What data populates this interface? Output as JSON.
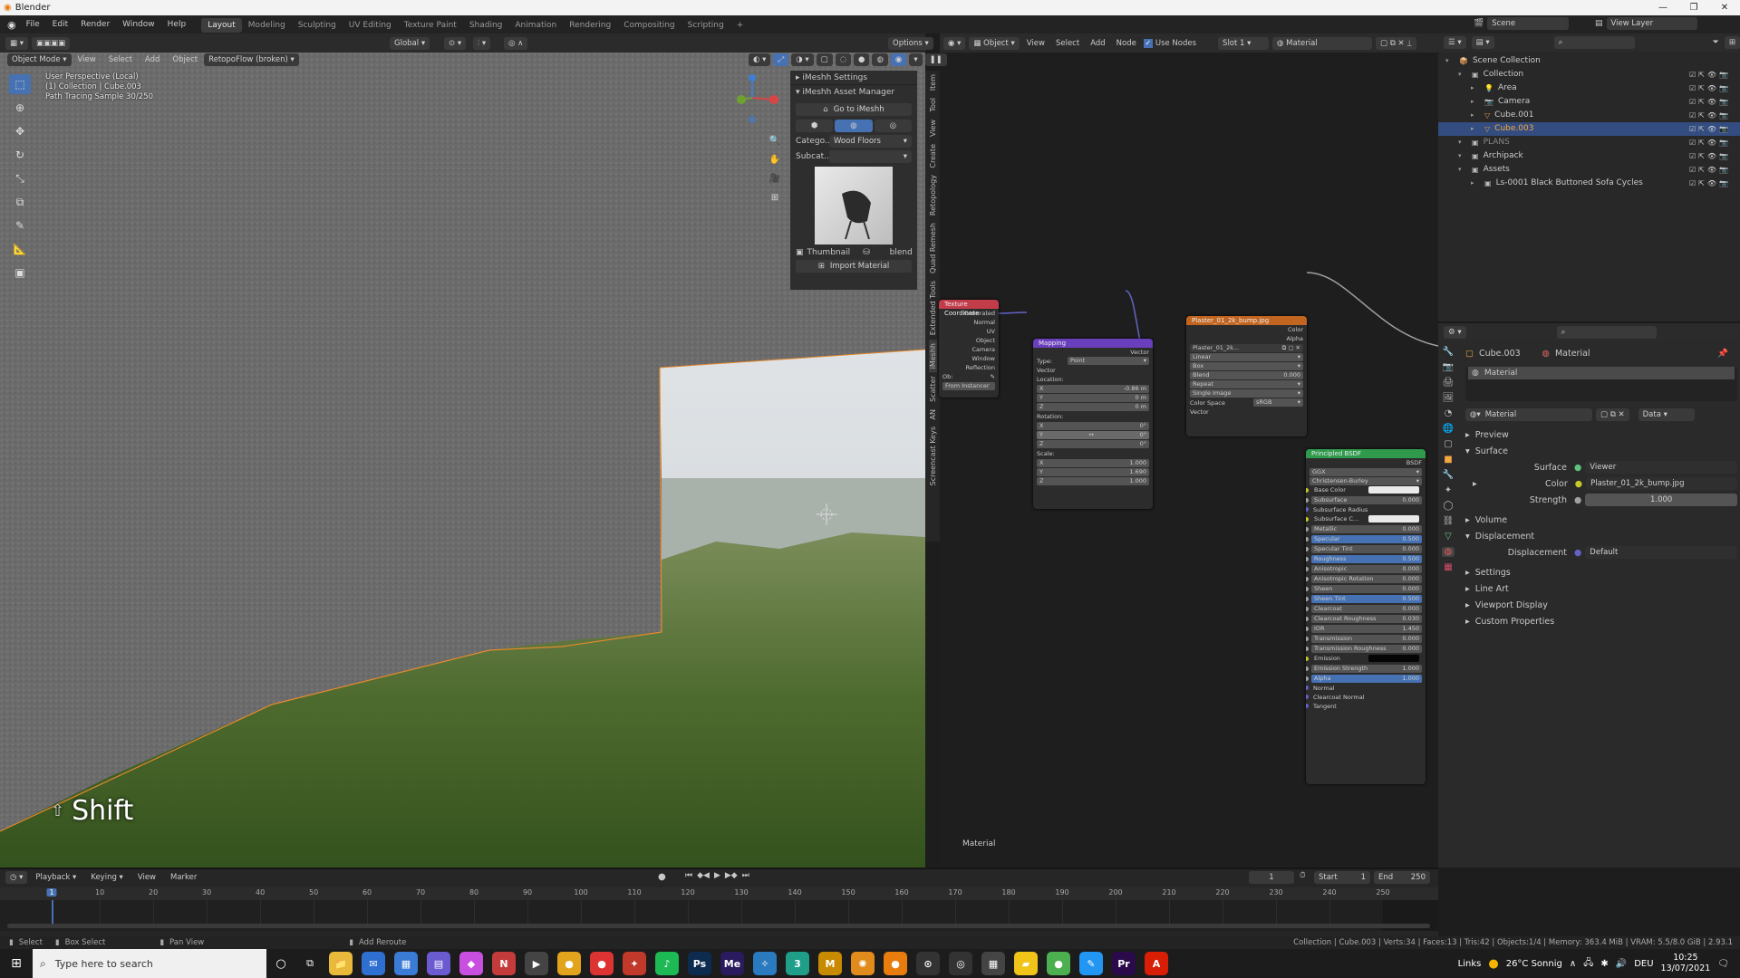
{
  "window": {
    "title": "Blender",
    "controls": [
      "—",
      "❐",
      "✕"
    ]
  },
  "menu": [
    "File",
    "Edit",
    "Render",
    "Window",
    "Help"
  ],
  "workspaces": [
    "Layout",
    "Modeling",
    "Sculpting",
    "UV Editing",
    "Texture Paint",
    "Shading",
    "Animation",
    "Rendering",
    "Compositing",
    "Scripting",
    "+"
  ],
  "topright": {
    "scene": "Scene",
    "view_layer": "View Layer"
  },
  "viewport": {
    "header": {
      "mode": "Object Mode",
      "menus": [
        "View",
        "Select",
        "Add",
        "Object"
      ],
      "addon": "RetopoFlow (broken)",
      "transform": "Global",
      "options": "Options"
    },
    "info": [
      "User Perspective (Local)",
      "(1) Collection | Cube.003",
      "Path Tracing Sample 30/250"
    ],
    "shift_label": "Shift",
    "gizmo_colors": {
      "x": "#d94545",
      "y": "#6ea130",
      "z": "#3d7fd0"
    }
  },
  "imeshh": {
    "settings_label": "iMeshh Settings",
    "manager_label": "iMeshh Asset Manager",
    "goto_label": "Go to iMeshh",
    "category_label": "Catego...",
    "category_value": "Wood Floors",
    "subcat_label": "Subcat...",
    "thumbnail_label": "Thumbnail",
    "blend_label": "blend",
    "import_label": "Import Material"
  },
  "side_tabs": [
    "Item",
    "Tool",
    "View",
    "Create",
    "Retopology",
    "Quad Remesh",
    "Extended Tools",
    "iMeshh",
    "Scatter",
    "AN",
    "Screencast Keys"
  ],
  "node_editor": {
    "header": {
      "object_mode": "Object",
      "menus": [
        "View",
        "Select",
        "Add",
        "Node"
      ],
      "use_nodes": "Use Nodes",
      "slot": "Slot 1",
      "material": "Material"
    },
    "footer_label": "Material",
    "tex_coord": {
      "title": "Texture Coordinate",
      "outputs": [
        "Generated",
        "Normal",
        "UV",
        "Object",
        "Camera",
        "Window",
        "Reflection"
      ],
      "object_label": "Ob:",
      "from_instancer": "From Instancer"
    },
    "mapping": {
      "title": "Mapping",
      "output": "Vector",
      "type_label": "Type:",
      "type_value": "Point",
      "input": "Vector",
      "location_label": "Location:",
      "location": [
        [
          "X",
          "-0.86 m"
        ],
        [
          "Y",
          "0 m"
        ],
        [
          "Z",
          "0 m"
        ]
      ],
      "rotation_label": "Rotation:",
      "rotation": [
        [
          "X",
          "0°"
        ],
        [
          "Y",
          "0°"
        ],
        [
          "Z",
          "0°"
        ]
      ],
      "scale_label": "Scale:",
      "scale": [
        [
          "X",
          "1.000"
        ],
        [
          "Y",
          "1.690"
        ],
        [
          "Z",
          "1.000"
        ]
      ]
    },
    "image": {
      "title": "Plaster_01_2k_bump.jpg",
      "outputs": [
        "Color",
        "Alpha"
      ],
      "file": "Plaster_01_2k...",
      "interp": "Linear",
      "proj": "Box",
      "blend_label": "Blend",
      "blend_value": "0.000",
      "ext": "Repeat",
      "source": "Single Image",
      "cs_label": "Color Space",
      "cs_value": "sRGB",
      "input": "Vector"
    },
    "bsdf": {
      "title": "Principled BSDF",
      "output": "BSDF",
      "dist": "GGX",
      "sss_method": "Christensen-Burley",
      "inputs": [
        {
          "label": "Base Color",
          "value": "",
          "kind": "color-white",
          "sock": "#c7c729"
        },
        {
          "label": "Subsurface",
          "value": "0.000",
          "kind": "field",
          "sock": "#a1a1a1"
        },
        {
          "label": "Subsurface Radius",
          "value": "",
          "kind": "text",
          "sock": "#6363c7"
        },
        {
          "label": "Subsurface C...",
          "value": "",
          "kind": "color-white",
          "sock": "#c7c729"
        },
        {
          "label": "Metallic",
          "value": "0.000",
          "kind": "field",
          "sock": "#a1a1a1"
        },
        {
          "label": "Specular",
          "value": "0.500",
          "kind": "blue",
          "sock": "#a1a1a1"
        },
        {
          "label": "Specular Tint",
          "value": "0.000",
          "kind": "field",
          "sock": "#a1a1a1"
        },
        {
          "label": "Roughness",
          "value": "0.500",
          "kind": "blue",
          "sock": "#a1a1a1"
        },
        {
          "label": "Anisotropic",
          "value": "0.000",
          "kind": "field",
          "sock": "#a1a1a1"
        },
        {
          "label": "Anisotropic Rotation",
          "value": "0.000",
          "kind": "field",
          "sock": "#a1a1a1"
        },
        {
          "label": "Sheen",
          "value": "0.000",
          "kind": "field",
          "sock": "#a1a1a1"
        },
        {
          "label": "Sheen Tint",
          "value": "0.500",
          "kind": "blue",
          "sock": "#a1a1a1"
        },
        {
          "label": "Clearcoat",
          "value": "0.000",
          "kind": "field",
          "sock": "#a1a1a1"
        },
        {
          "label": "Clearcoat Roughness",
          "value": "0.030",
          "kind": "field",
          "sock": "#a1a1a1"
        },
        {
          "label": "IOR",
          "value": "1.450",
          "kind": "field",
          "sock": "#a1a1a1"
        },
        {
          "label": "Transmission",
          "value": "0.000",
          "kind": "field",
          "sock": "#a1a1a1"
        },
        {
          "label": "Transmission Roughness",
          "value": "0.000",
          "kind": "field",
          "sock": "#a1a1a1"
        },
        {
          "label": "Emission",
          "value": "",
          "kind": "color-black",
          "sock": "#c7c729"
        },
        {
          "label": "Emission Strength",
          "value": "1.000",
          "kind": "field",
          "sock": "#a1a1a1"
        },
        {
          "label": "Alpha",
          "value": "1.000",
          "kind": "blue",
          "sock": "#a1a1a1"
        },
        {
          "label": "Normal",
          "value": "",
          "kind": "text",
          "sock": "#6363c7"
        },
        {
          "label": "Clearcoat Normal",
          "value": "",
          "kind": "text",
          "sock": "#6363c7"
        },
        {
          "label": "Tangent",
          "value": "",
          "kind": "text",
          "sock": "#6363c7"
        }
      ]
    }
  },
  "outliner": {
    "items": [
      {
        "label": "Scene Collection",
        "depth": 0,
        "icon": "📦",
        "color": "#ccc",
        "vis": false
      },
      {
        "label": "Collection",
        "depth": 1,
        "icon": "▣",
        "color": "#ccc",
        "vis": true
      },
      {
        "label": "Area",
        "depth": 2,
        "icon": "💡",
        "color": "#ccc",
        "vis": true
      },
      {
        "label": "Camera",
        "depth": 2,
        "icon": "📷",
        "color": "#ccc",
        "vis": true
      },
      {
        "label": "Cube.001",
        "depth": 2,
        "icon": "▽",
        "color": "#ccc",
        "vis": true
      },
      {
        "label": "Cube.003",
        "depth": 2,
        "icon": "▽",
        "color": "#f5a742",
        "vis": true,
        "selected": true
      },
      {
        "label": "PLANS",
        "depth": 1,
        "icon": "▣",
        "color": "#888",
        "vis": true
      },
      {
        "label": "Archipack",
        "depth": 1,
        "icon": "▣",
        "color": "#ccc",
        "vis": true
      },
      {
        "label": "Assets",
        "depth": 1,
        "icon": "▣",
        "color": "#ccc",
        "vis": true
      },
      {
        "label": "Ls-0001 Black Buttoned Sofa Cycles",
        "depth": 2,
        "icon": "▣",
        "color": "#ccc",
        "vis": true
      }
    ]
  },
  "properties": {
    "object": "Cube.003",
    "material_tab": "Material",
    "slot": "Material",
    "material_name": "Material",
    "data_label": "Data",
    "sections": {
      "preview": "Preview",
      "surface": "Surface",
      "volume": "Volume",
      "displacement": "Displacement",
      "settings": "Settings",
      "line_art": "Line Art",
      "viewport_display": "Viewport Display",
      "custom_props": "Custom Properties"
    },
    "surface_label": "Surface",
    "surface_value": "Viewer",
    "color_label": "Color",
    "color_value": "Plaster_01_2k_bump.jpg",
    "strength_label": "Strength",
    "strength_value": "1.000",
    "disp_label": "Displacement",
    "disp_value": "Default"
  },
  "timeline": {
    "menus": [
      "Playback",
      "Keying",
      "View",
      "Marker"
    ],
    "current_frame": "1",
    "start_label": "Start",
    "start": "1",
    "end_label": "End",
    "end": "250",
    "ticks": [
      "1",
      "10",
      "20",
      "30",
      "40",
      "50",
      "60",
      "70",
      "80",
      "90",
      "100",
      "110",
      "120",
      "130",
      "140",
      "150",
      "160",
      "170",
      "180",
      "190",
      "200",
      "210",
      "220",
      "230",
      "240",
      "250"
    ]
  },
  "statusbar": {
    "select": "Select",
    "box_select": "Box Select",
    "pan_view": "Pan View",
    "add_reroute": "Add Reroute",
    "stats": "Collection | Cube.003 | Verts:34 | Faces:13 | Tris:42 | Objects:1/4 | Memory: 363.4 MiB | VRAM: 5.5/8.0 GiB | 2.93.1"
  },
  "taskbar": {
    "search_placeholder": "Type here to search",
    "apps": [
      {
        "icon": "📁",
        "color": "#e8b93a"
      },
      {
        "icon": "✉",
        "color": "#2f6fd1"
      },
      {
        "icon": "▦",
        "color": "#3a7bd5"
      },
      {
        "icon": "▤",
        "color": "#6b5bd1"
      },
      {
        "icon": "◆",
        "color": "#c94fe0"
      },
      {
        "icon": "N",
        "color": "#c43b3b"
      },
      {
        "icon": "▶",
        "color": "#444"
      },
      {
        "icon": "●",
        "color": "#e2a41c"
      },
      {
        "icon": "●",
        "color": "#d33"
      },
      {
        "icon": "✦",
        "color": "#c0392b"
      },
      {
        "icon": "♪",
        "color": "#1db954"
      },
      {
        "icon": "Ps",
        "color": "#0d2b4f"
      },
      {
        "icon": "Me",
        "color": "#2a1a5e"
      },
      {
        "icon": "✧",
        "color": "#2a7abf"
      },
      {
        "icon": "3",
        "color": "#1f9e8a"
      },
      {
        "icon": "M",
        "color": "#c78a00"
      },
      {
        "icon": "✺",
        "color": "#e08b1b"
      },
      {
        "icon": "●",
        "color": "#e87d0d"
      },
      {
        "icon": "⊙",
        "color": "#333"
      },
      {
        "icon": "◎",
        "color": "#333"
      },
      {
        "icon": "▦",
        "color": "#444"
      },
      {
        "icon": "▰",
        "color": "#f0c419"
      },
      {
        "icon": "●",
        "color": "#4caf50"
      },
      {
        "icon": "✎",
        "color": "#2196f3"
      },
      {
        "icon": "Pr",
        "color": "#2a0a4a"
      },
      {
        "icon": "A",
        "color": "#d81e05"
      }
    ],
    "links": "Links",
    "weather": "26°C  Sonnig",
    "lang": "DEU",
    "time": "10:25",
    "date": "13/07/2021"
  }
}
